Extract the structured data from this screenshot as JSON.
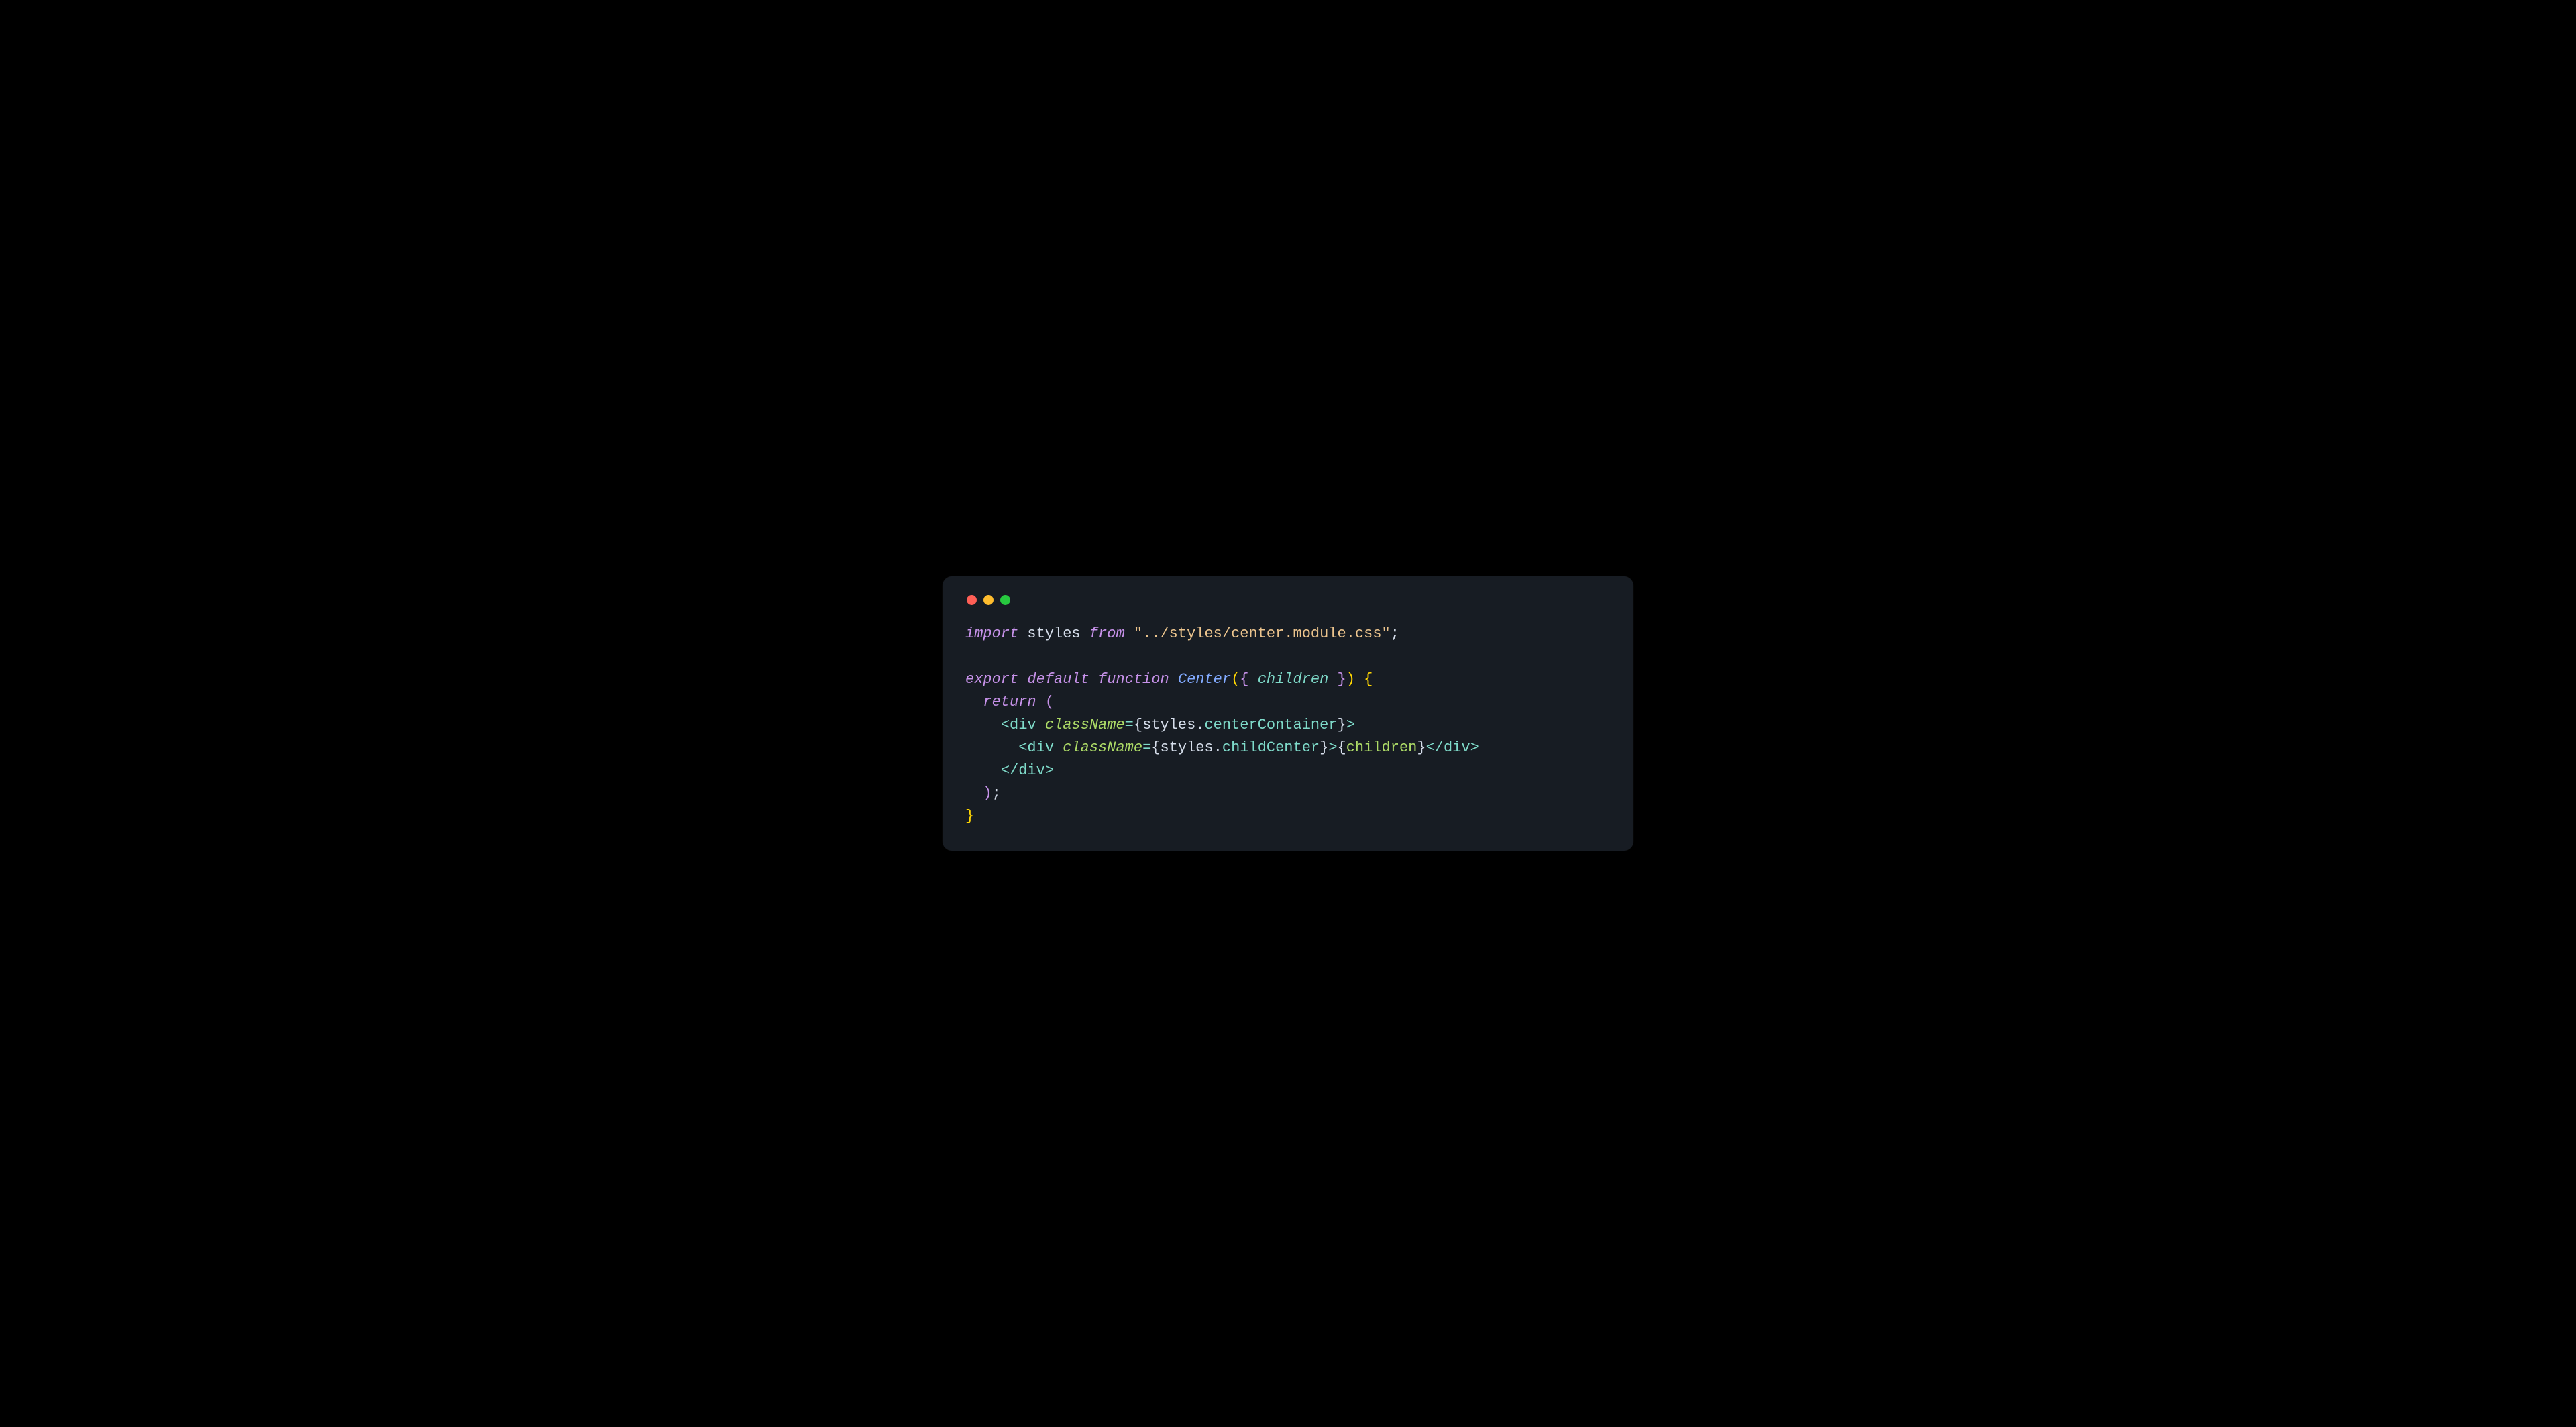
{
  "window": {
    "traffic_lights": {
      "close_color": "#ff5f56",
      "minimize_color": "#ffbd2e",
      "zoom_color": "#27c93f"
    }
  },
  "code": {
    "line1": {
      "kw_import": "import",
      "ident_styles": "styles",
      "kw_from": "from",
      "str_quote_open": "\"",
      "str_path": "../styles/center.module.css",
      "str_quote_close": "\"",
      "semi": ";"
    },
    "line3": {
      "kw_export": "export",
      "kw_default": "default",
      "kw_function": "function",
      "fn_name": "Center",
      "paren_open": "(",
      "brace_open_param": "{",
      "param_children": "children",
      "brace_close_param": "}",
      "paren_close": ")",
      "brace_open_body": "{"
    },
    "line4": {
      "indent": "  ",
      "kw_return": "return",
      "paren_open": "("
    },
    "line5": {
      "indent": "    ",
      "lt": "<",
      "tag": "div",
      "attr": "className",
      "eq": "=",
      "brace_open": "{",
      "obj": "styles",
      "dot": ".",
      "prop": "centerContainer",
      "brace_close": "}",
      "gt": ">"
    },
    "line6": {
      "indent": "      ",
      "lt": "<",
      "tag": "div",
      "attr": "className",
      "eq": "=",
      "brace_open": "{",
      "obj": "styles",
      "dot": ".",
      "prop": "childCenter",
      "brace_close": "}",
      "gt": ">",
      "child_brace_open": "{",
      "child_expr": "children",
      "child_brace_close": "}",
      "lt2": "<",
      "slash2": "/",
      "tag2": "div",
      "gt2": ">"
    },
    "line7": {
      "indent": "    ",
      "lt": "<",
      "slash": "/",
      "tag": "div",
      "gt": ">"
    },
    "line8": {
      "indent": "  ",
      "paren_close": ")",
      "semi": ";"
    },
    "line9": {
      "brace_close_body": "}"
    }
  }
}
